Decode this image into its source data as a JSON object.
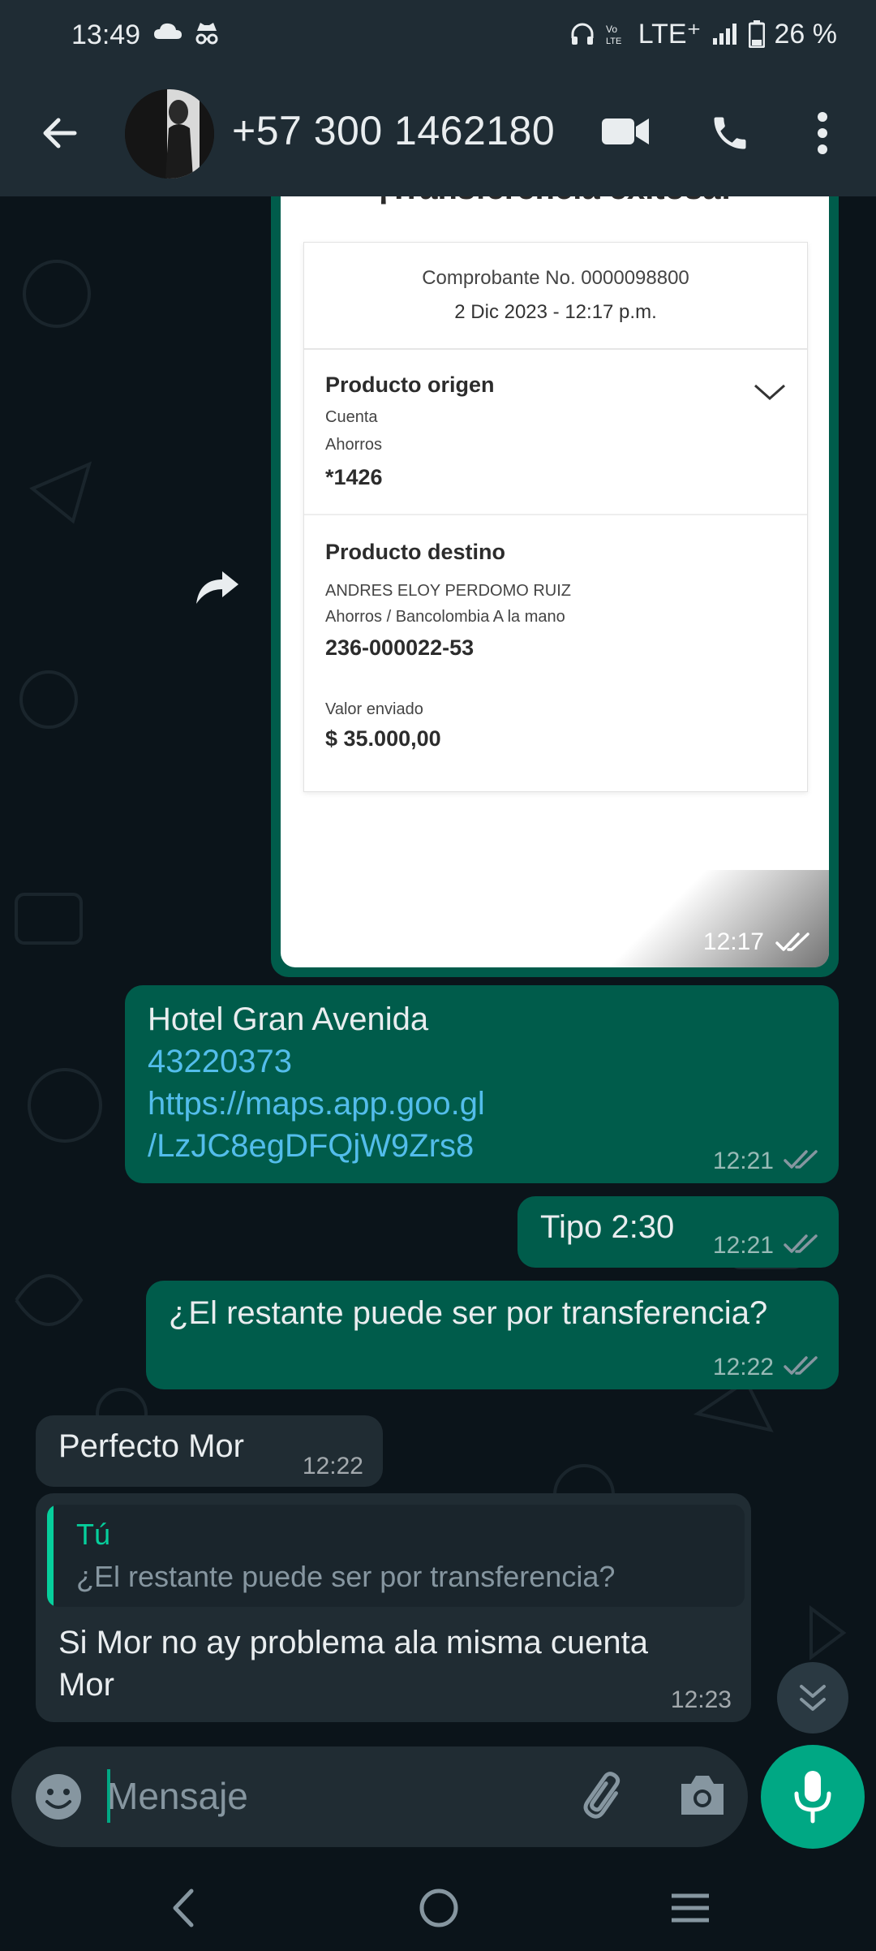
{
  "status_bar": {
    "time": "13:49",
    "network": "LTE⁺",
    "battery": "26 %"
  },
  "header": {
    "contact": "+57 300 1462180"
  },
  "image_message": {
    "heading": "¡Transferencia exitosa!",
    "receipt_no": "Comprobante No. 0000098800",
    "date": "2 Dic 2023 - 12:17 p.m.",
    "origin_title": "Producto origen",
    "origin_label1": "Cuenta",
    "origin_label2": "Ahorros",
    "origin_account": "*1426",
    "dest_title": "Producto destino",
    "dest_name": "ANDRES ELOY PERDOMO RUIZ",
    "dest_type": "Ahorros / Bancolombia A la mano",
    "dest_account": "236-000022-53",
    "amount_label": "Valor enviado",
    "amount": "$ 35.000,00",
    "time": "12:17"
  },
  "messages": [
    {
      "text": "Hotel Gran Avenida",
      "link1": "43220373",
      "link2": "https://maps.app.goo.gl",
      "link3": "/LzJC8egDFQjW9Zrs8",
      "time": "12:21"
    },
    {
      "text": "Tipo 2:30",
      "time": "12:21"
    },
    {
      "text": "¿El restante puede ser por transferencia?",
      "time": "12:22"
    },
    {
      "text": "Perfecto Mor",
      "time": "12:22"
    },
    {
      "quote_author": "Tú",
      "quote_text": "¿El restante puede ser por transferencia?",
      "text_line1": "Si Mor no ay problema ala misma cuenta",
      "text_line2": "Mor",
      "time": "12:23"
    }
  ],
  "input": {
    "placeholder": "Mensaje"
  },
  "colors": {
    "outgoing": "#005c4b",
    "incoming": "#202c33",
    "accent": "#00a884",
    "link": "#53bdeb"
  }
}
